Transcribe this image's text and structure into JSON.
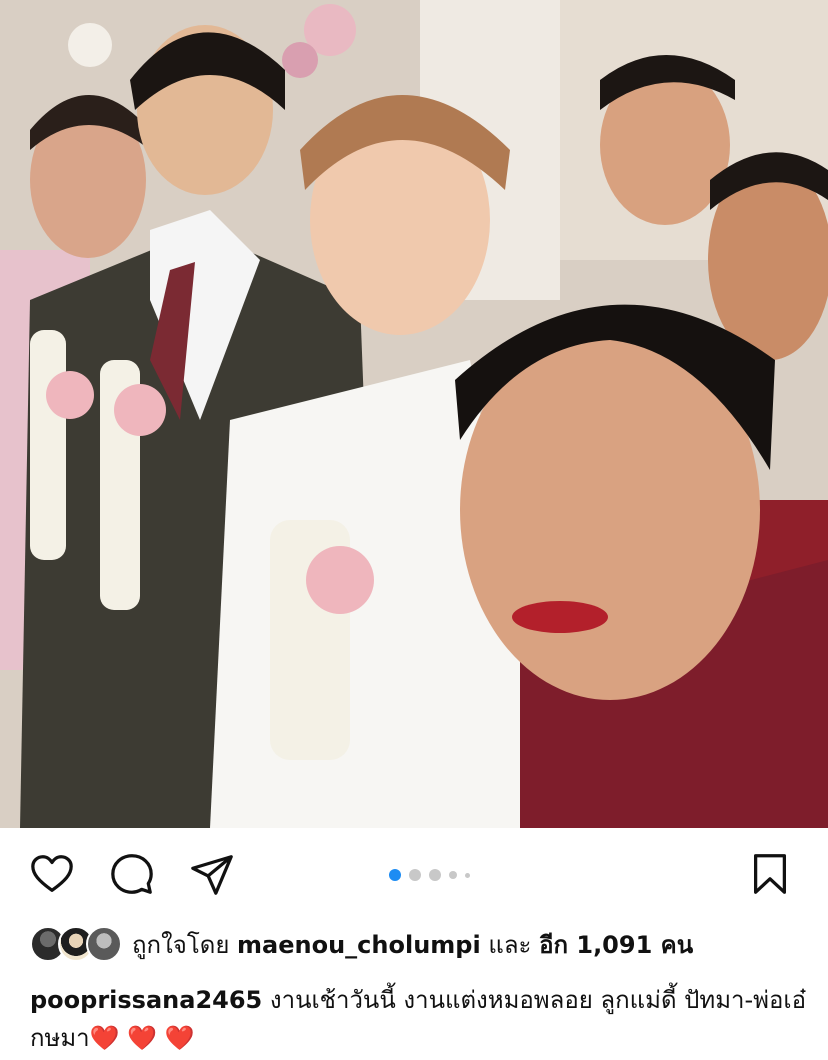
{
  "post": {
    "photo_alt": "wedding selfie",
    "carousel": {
      "count": 5,
      "active_index": 0
    }
  },
  "actions": {
    "like_icon": "heart-outline-icon",
    "comment_icon": "comment-icon",
    "share_icon": "send-icon",
    "save_icon": "bookmark-icon"
  },
  "likes": {
    "prefix": "ถูกใจโดย",
    "liker": "maenou_cholumpi",
    "connector": "และ",
    "others": "อีก 1,091 คน"
  },
  "caption": {
    "username": "pooprissana2465",
    "text": " งานเช้าวันนี้ งานแต่งหมอพลอย ลูกแม่ดี้ ปัทมา-พ่อเอ๋กษมา",
    "hearts": "❤️ ❤️ ❤️"
  },
  "colors": {
    "accent": "#1d8cf3",
    "heart": "#e0232a",
    "text": "#111111"
  }
}
